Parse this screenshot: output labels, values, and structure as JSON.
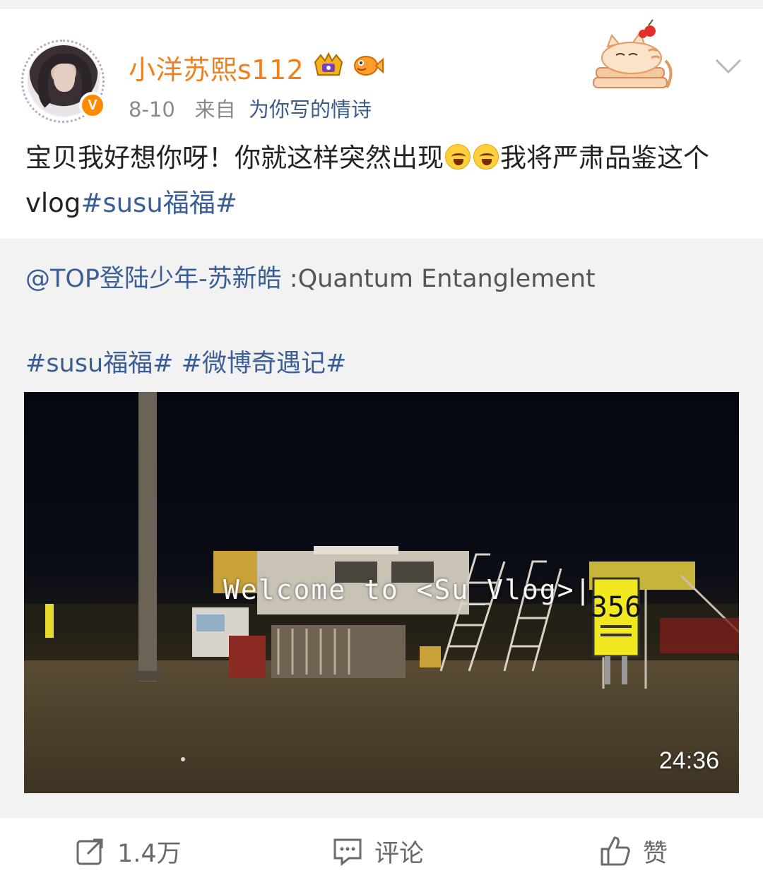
{
  "post": {
    "username": "小洋苏熙s112",
    "date": "8-10",
    "from_label": "来自",
    "source": "为你写的情诗",
    "text_part1": "宝贝我好想你呀！你就这样突然出现",
    "text_part2": "我将严肃品鉴这个vlog",
    "topic": "#susu福福#",
    "emoji": "laugh-tears-emoji"
  },
  "repost": {
    "mention": "@TOP登陆少年-苏新皓",
    "title_text": " :Quantum Entanglement",
    "topics": "#susu福福# #微博奇遇记#"
  },
  "video": {
    "overlay_title": "Welcome to <Su_Vlog>|",
    "sign_number": "356",
    "duration": "24:36"
  },
  "actions": {
    "repost_count": "1.4万",
    "comment_label": "评论",
    "like_label": "赞"
  },
  "colors": {
    "username": "#f0801a",
    "link": "#3a5e95",
    "verified": "#ff8a00"
  },
  "icons": [
    "chevron-down-icon",
    "repost-icon",
    "comment-icon",
    "like-icon",
    "crown-badge-icon",
    "fish-badge-icon",
    "cat-sticker-icon"
  ]
}
